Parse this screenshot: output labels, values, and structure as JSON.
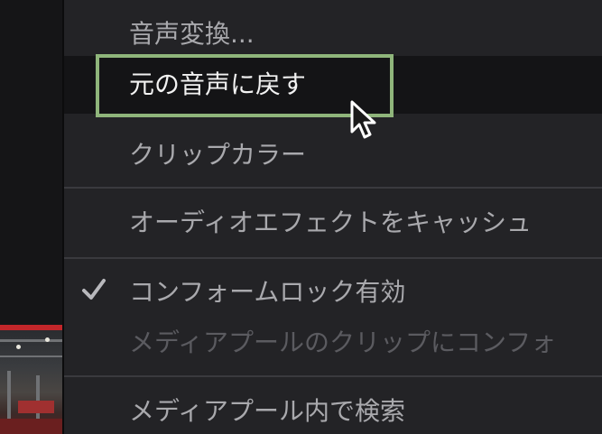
{
  "menu": {
    "items": [
      {
        "label": "音声変換..."
      },
      {
        "label": "元の音声に戻す"
      },
      {
        "label": "クリップカラー"
      },
      {
        "label": "オーディオエフェクトをキャッシュ"
      },
      {
        "label": "コンフォームロック有効",
        "checked": true
      },
      {
        "label": "メディアプールのクリップにコンフォ"
      },
      {
        "label": "メディアプール内で検索"
      }
    ]
  },
  "icons": {
    "check": "checkmark-icon",
    "cursor": "arrow-cursor-icon"
  },
  "colors": {
    "highlight_border": "#8fb57b",
    "timeline_marker": "#c2262a",
    "menu_background": "#232326",
    "active_item_background": "#141416"
  }
}
